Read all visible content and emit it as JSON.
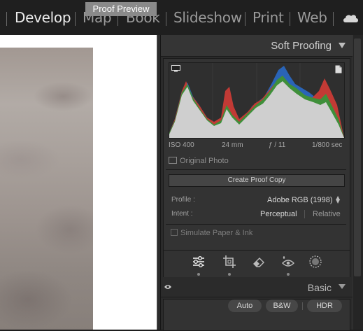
{
  "modules": {
    "develop": "Develop",
    "map": "Map",
    "book": "Book",
    "slideshow": "Slideshow",
    "print": "Print",
    "web": "Web"
  },
  "preview": {
    "label": "Proof Preview"
  },
  "soft_proofing": {
    "title": "Soft Proofing",
    "meta": {
      "iso": "ISO 400",
      "focal": "24 mm",
      "aperture": "ƒ / 11",
      "shutter": "1/800 sec"
    },
    "original_photo": "Original Photo",
    "create_proof_copy": "Create Proof Copy",
    "profile_label": "Profile :",
    "profile_value": "Adobe RGB (1998)",
    "intent_label": "Intent :",
    "intent_perceptual": "Perceptual",
    "intent_relative": "Relative",
    "simulate": "Simulate Paper & Ink"
  },
  "tools": [
    "edit-sliders-icon",
    "crop-icon",
    "eraser-icon",
    "red-eye-icon",
    "masking-icon"
  ],
  "basic": {
    "title": "Basic",
    "auto": "Auto",
    "bw": "B&W",
    "hdr": "HDR"
  },
  "colors": {
    "accent_active": "#ececec",
    "inactive": "#9a9a9a",
    "panel_bg": "#2b2b2b"
  }
}
